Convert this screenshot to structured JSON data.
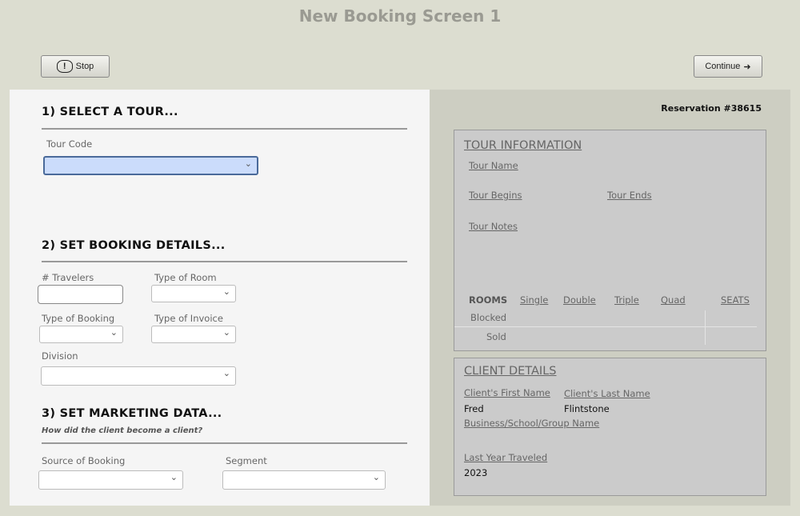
{
  "title": "New Booking Screen 1",
  "toolbar": {
    "stop_label": "Stop",
    "continue_label": "Continue"
  },
  "section1": {
    "heading": "1) SELECT A TOUR...",
    "tour_code_label": "Tour Code",
    "tour_code_value": ""
  },
  "section2": {
    "heading": "2) SET BOOKING DETAILS...",
    "travelers_label": "# Travelers",
    "room_type_label": "Type of Room",
    "booking_type_label": "Type of Booking",
    "invoice_type_label": "Type of Invoice",
    "division_label": "Division"
  },
  "section3": {
    "heading": "3) SET MARKETING DATA...",
    "subtitle": "How did the client become a client?",
    "source_label": "Source of Booking",
    "segment_label": "Segment"
  },
  "reservation": "Reservation #38615",
  "tour_info": {
    "heading": "TOUR INFORMATION",
    "name_label": "Tour Name",
    "begins_label": "Tour Begins",
    "ends_label": "Tour Ends",
    "notes_label": "Tour Notes",
    "rooms": {
      "header": "ROOMS",
      "columns": [
        "Single",
        "Double",
        "Triple",
        "Quad"
      ],
      "seats": "SEATS",
      "rows": [
        "Blocked",
        "Sold"
      ]
    }
  },
  "client": {
    "heading": "CLIENT DETAILS",
    "first_label": "Client's First Name",
    "first_value": "Fred",
    "last_label": "Client's Last Name",
    "last_value": "Flintstone",
    "business_label": "Business/School/Group Name",
    "last_year_label": "Last Year Traveled",
    "last_year_value": "2023"
  }
}
